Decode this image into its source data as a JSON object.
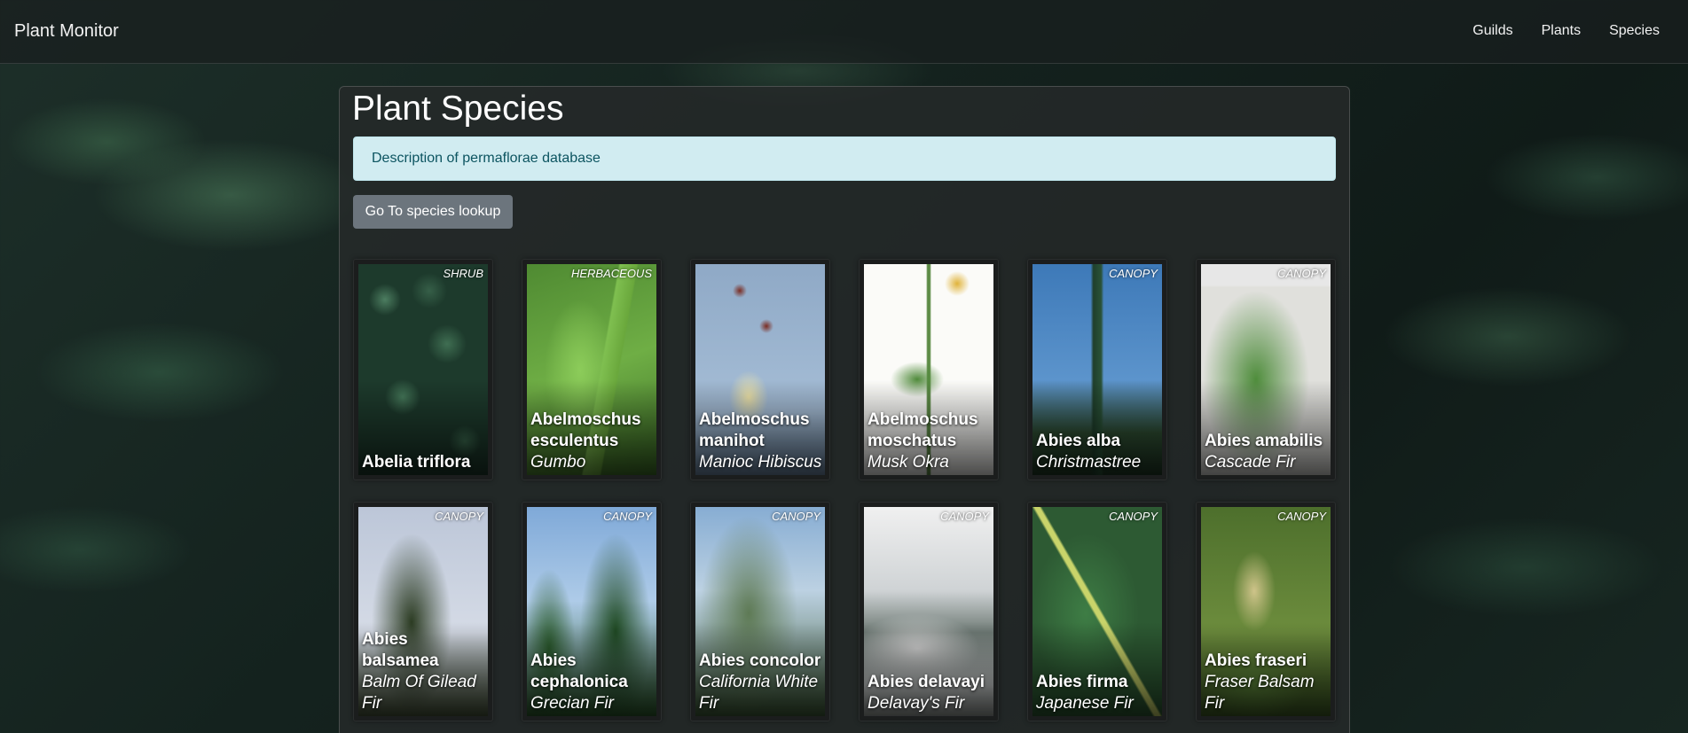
{
  "nav": {
    "brand": "Plant Monitor",
    "links": [
      "Guilds",
      "Plants",
      "Species"
    ]
  },
  "page": {
    "title": "Plant Species",
    "info_text": "Description of permaflorae database",
    "lookup_button": "Go To species lookup"
  },
  "species": [
    {
      "scientific": "Abelia triflora",
      "common": "",
      "layer": "SHRUB"
    },
    {
      "scientific": "Abelmoschus esculentus",
      "common": "Gumbo",
      "layer": "HERBACEOUS"
    },
    {
      "scientific": "Abelmoschus manihot",
      "common": "Manioc Hibiscus",
      "layer": ""
    },
    {
      "scientific": "Abelmoschus moschatus",
      "common": "Musk Okra",
      "layer": ""
    },
    {
      "scientific": "Abies alba",
      "common": "Christmastree",
      "layer": "CANOPY"
    },
    {
      "scientific": "Abies amabilis",
      "common": "Cascade Fir",
      "layer": "CANOPY"
    },
    {
      "scientific": "Abies balsamea",
      "common": "Balm Of Gilead Fir",
      "layer": "CANOPY"
    },
    {
      "scientific": "Abies cephalonica",
      "common": "Grecian Fir",
      "layer": "CANOPY"
    },
    {
      "scientific": "Abies concolor",
      "common": "California White Fir",
      "layer": "CANOPY"
    },
    {
      "scientific": "Abies delavayi",
      "common": "Delavay's Fir",
      "layer": "CANOPY"
    },
    {
      "scientific": "Abies firma",
      "common": "Japanese Fir",
      "layer": "CANOPY"
    },
    {
      "scientific": "Abies fraseri",
      "common": "Fraser Balsam Fir",
      "layer": "CANOPY"
    }
  ]
}
